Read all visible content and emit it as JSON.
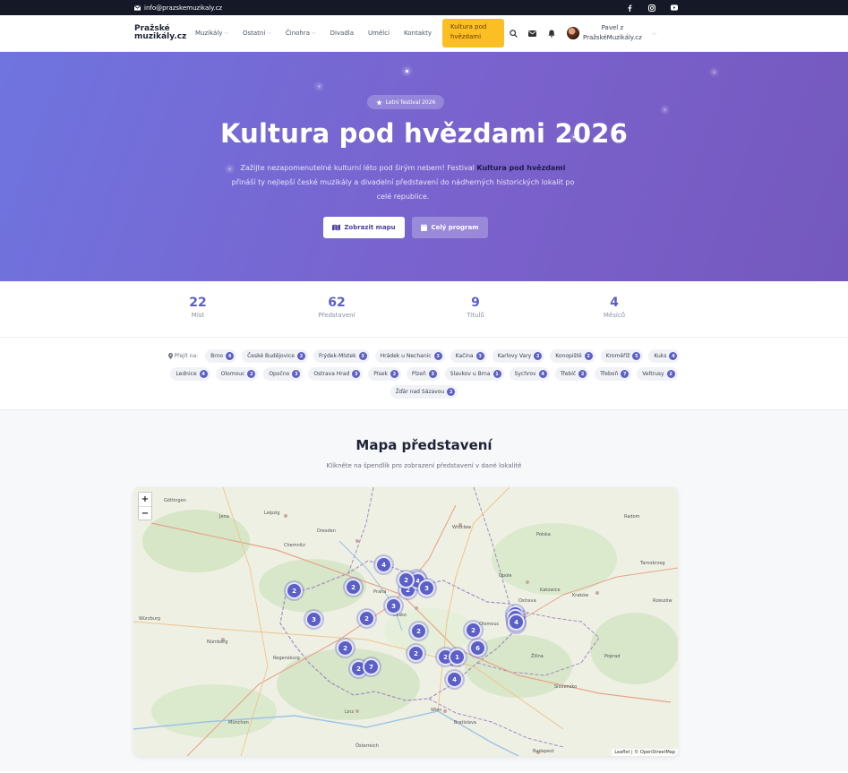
{
  "topbar": {
    "email": "info@prazskemuzikaly.cz",
    "socials": [
      "facebook-icon",
      "instagram-icon",
      "youtube-icon"
    ]
  },
  "nav": {
    "logo_line1": "Pražské",
    "logo_line2": "muzikály.cz",
    "items": [
      {
        "label": "Muzikály",
        "dropdown": true
      },
      {
        "label": "Ostatní",
        "dropdown": true
      },
      {
        "label": "Činohra",
        "dropdown": true
      },
      {
        "label": "Divadla",
        "dropdown": false
      },
      {
        "label": "Umělci",
        "dropdown": false
      },
      {
        "label": "Kontakty",
        "dropdown": false
      }
    ],
    "cta": "Kultura pod hvězdami",
    "user_line1": "Pavel z",
    "user_line2": "PražskéMuzikály.cz"
  },
  "hero": {
    "badge": "Letní festival 2026",
    "title": "Kultura pod hvězdami 2026",
    "lead_before": "Zažijte nezapomenutelné kulturní léto pod širým nebem! Festival ",
    "lead_bold": "Kultura pod hvězdami",
    "lead_after": " přináší ty nejlepší české muzikály a divadelní představení do nádherných historických lokalit po celé republice.",
    "btn_map": "Zobrazit mapu",
    "btn_program": "Celý program"
  },
  "stats": [
    {
      "value": "22",
      "label": "Míst"
    },
    {
      "value": "62",
      "label": "Představení"
    },
    {
      "value": "9",
      "label": "Titulů"
    },
    {
      "value": "4",
      "label": "Měsíců"
    }
  ],
  "jump": {
    "label": "Přejít na:",
    "rows": [
      [
        {
          "name": "Brno",
          "count": "4"
        },
        {
          "name": "České Budějovice",
          "count": "2"
        },
        {
          "name": "Frýdek-Místek",
          "count": "3"
        },
        {
          "name": "Hrádek u Nechanic",
          "count": "3"
        },
        {
          "name": "Kačina",
          "count": "3"
        },
        {
          "name": "Karlovy Vary",
          "count": "2"
        },
        {
          "name": "Konopiště",
          "count": "2"
        },
        {
          "name": "Kroměříž",
          "count": "5"
        },
        {
          "name": "Kuks",
          "count": "4"
        }
      ],
      [
        {
          "name": "Lednice",
          "count": "4"
        },
        {
          "name": "Olomouc",
          "count": "2"
        },
        {
          "name": "Opočno",
          "count": "3"
        },
        {
          "name": "Ostrava Hrad",
          "count": "3"
        },
        {
          "name": "Písek",
          "count": "2"
        },
        {
          "name": "Plzeň",
          "count": "3"
        },
        {
          "name": "Slavkov u Brna",
          "count": "1"
        },
        {
          "name": "Sychrov",
          "count": "4"
        },
        {
          "name": "Třebíč",
          "count": "2"
        },
        {
          "name": "Třeboň",
          "count": "7"
        },
        {
          "name": "Veltrusy",
          "count": "2"
        }
      ],
      [
        {
          "name": "Žďár nad Sázavou",
          "count": "2"
        }
      ]
    ]
  },
  "map_section": {
    "title": "Mapa představení",
    "subtitle": "Klikněte na špendlík pro zobrazení představení v dané lokalitě",
    "zoom_in": "+",
    "zoom_out": "−",
    "attribution": "Leaflet | © OpenStreetMap",
    "markers": [
      "4",
      "2",
      "2",
      "2",
      "2",
      "4",
      "3",
      "3",
      "2",
      "3",
      "2",
      "2",
      "2",
      "2",
      "2",
      "7",
      "2",
      "4",
      "1",
      "6",
      "2",
      "2",
      "5",
      "4",
      "2"
    ],
    "cities": [
      "Leipzig",
      "Dresden",
      "Wrocław",
      "Chemnitz",
      "Nürnberg",
      "Regensburg",
      "München",
      "Linz",
      "Wien",
      "Bratislava",
      "Kraków",
      "Katowice",
      "Radom",
      "Tarnobrzeg",
      "Rzeszów",
      "Žilina",
      "Poprad",
      "Budapest",
      "Österreich",
      "Slovensko",
      "Polska",
      "Česko",
      "Würzburg",
      "Göttingen",
      "Praha",
      "Ostrava",
      "Brno",
      "Olomouc",
      "Opole",
      "Jena"
    ]
  }
}
